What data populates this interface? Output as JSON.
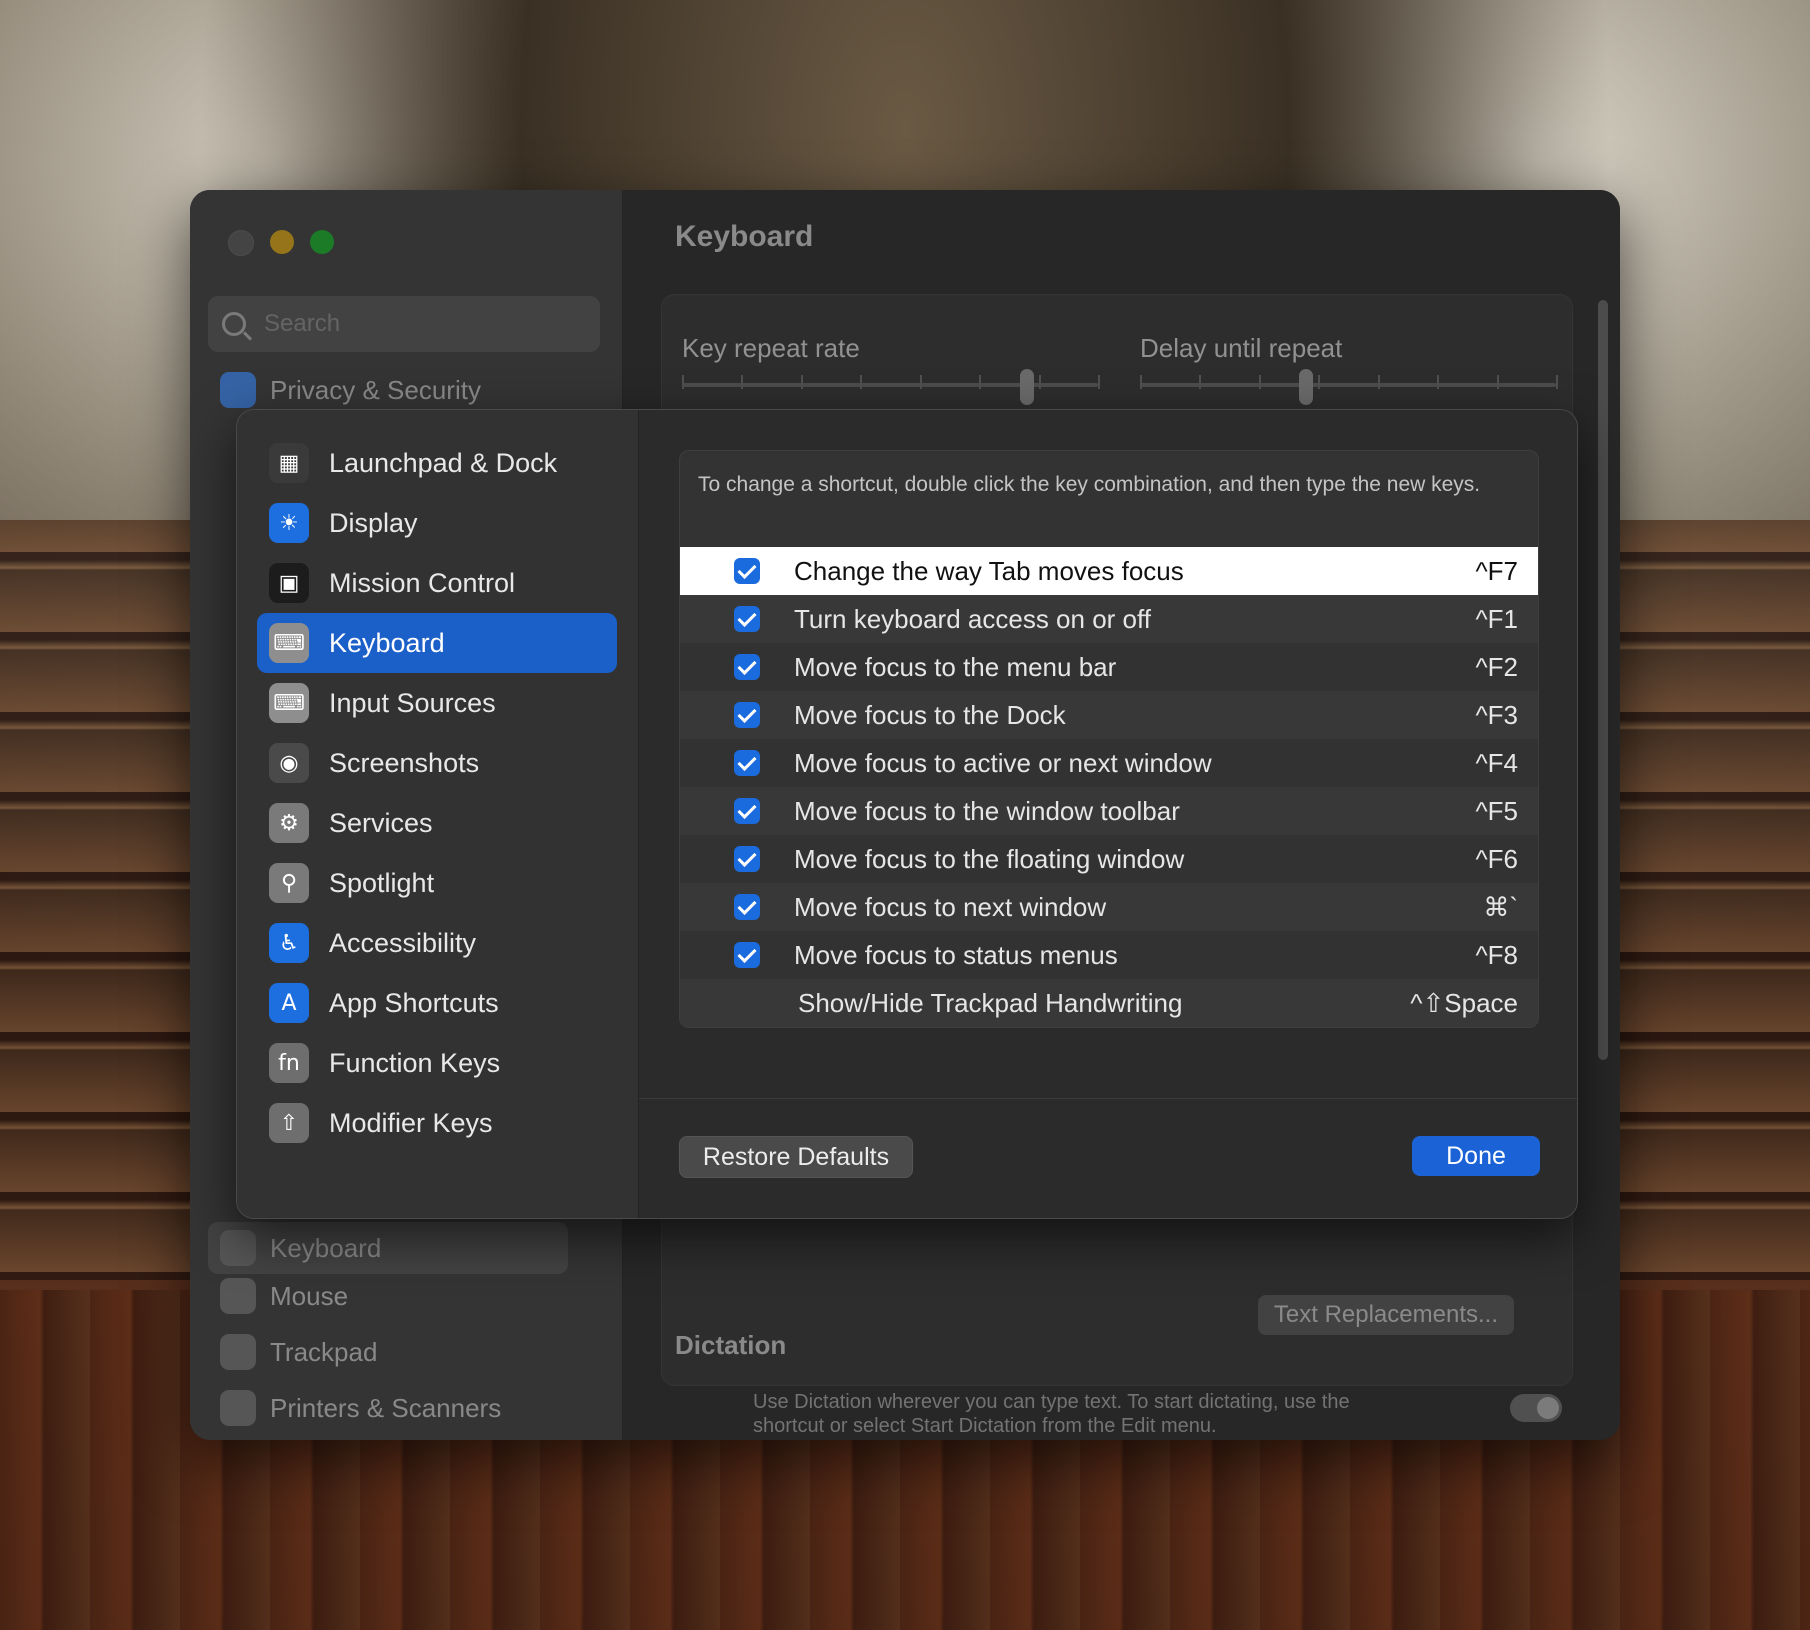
{
  "background_window": {
    "title": "Keyboard",
    "search_placeholder": "Search",
    "sidebar_top_item": "Privacy & Security",
    "sidebar_bottom_items": [
      "Keyboard",
      "Mouse",
      "Trackpad",
      "Printers & Scanners"
    ],
    "key_repeat_rate_label": "Key repeat rate",
    "delay_until_repeat_label": "Delay until repeat",
    "key_repeat_rate_level": 0.83,
    "delay_until_repeat_level": 0.4,
    "text_replacements_label": "Text Replacements...",
    "dictation_heading": "Dictation",
    "dictation_text": "Use Dictation wherever you can type text. To start dictating, use the shortcut or select Start Dictation from the Edit menu."
  },
  "sheet": {
    "sidebar": [
      {
        "label": "Launchpad & Dock",
        "icon": "launchpad-icon",
        "color": "#3a3a3a"
      },
      {
        "label": "Display",
        "icon": "display-sun-icon",
        "color": "#1d6fe0"
      },
      {
        "label": "Mission Control",
        "icon": "mission-control-icon",
        "color": "#1c1c1c"
      },
      {
        "label": "Keyboard",
        "icon": "keyboard-icon",
        "color": "#8e8e8e"
      },
      {
        "label": "Input Sources",
        "icon": "input-sources-icon",
        "color": "#8e8e8e"
      },
      {
        "label": "Screenshots",
        "icon": "screenshot-icon",
        "color": "#4a4a4a"
      },
      {
        "label": "Services",
        "icon": "gears-icon",
        "color": "#7a7a7a"
      },
      {
        "label": "Spotlight",
        "icon": "magnifier-icon",
        "color": "#7a7a7a"
      },
      {
        "label": "Accessibility",
        "icon": "accessibility-icon",
        "color": "#1d6fe0"
      },
      {
        "label": "App Shortcuts",
        "icon": "app-store-icon",
        "color": "#1d6fe0"
      },
      {
        "label": "Function Keys",
        "icon": "fn-key-icon",
        "color": "#6e6e6e"
      },
      {
        "label": "Modifier Keys",
        "icon": "up-arrow-key-icon",
        "color": "#6e6e6e"
      }
    ],
    "selected_index": 3,
    "instruction": "To change a shortcut, double click the key combination, and then type the new keys.",
    "shortcuts": [
      {
        "label": "Change the way Tab moves focus",
        "key": "^F7",
        "checked": true
      },
      {
        "label": "Turn keyboard access on or off",
        "key": "^F1",
        "checked": true
      },
      {
        "label": "Move focus to the menu bar",
        "key": "^F2",
        "checked": true
      },
      {
        "label": "Move focus to the Dock",
        "key": "^F3",
        "checked": true
      },
      {
        "label": "Move focus to active or next window",
        "key": "^F4",
        "checked": true
      },
      {
        "label": "Move focus to the window toolbar",
        "key": "^F5",
        "checked": true
      },
      {
        "label": "Move focus to the floating window",
        "key": "^F6",
        "checked": true
      },
      {
        "label": "Move focus to next window",
        "key": "⌘`",
        "checked": true
      },
      {
        "label": "Move focus to status menus",
        "key": "^F8",
        "checked": true
      },
      {
        "label": "Show/Hide Trackpad Handwriting",
        "key": "^⇧Space",
        "checked": false
      }
    ],
    "highlighted_row": 0,
    "restore_defaults_label": "Restore Defaults",
    "done_label": "Done"
  }
}
